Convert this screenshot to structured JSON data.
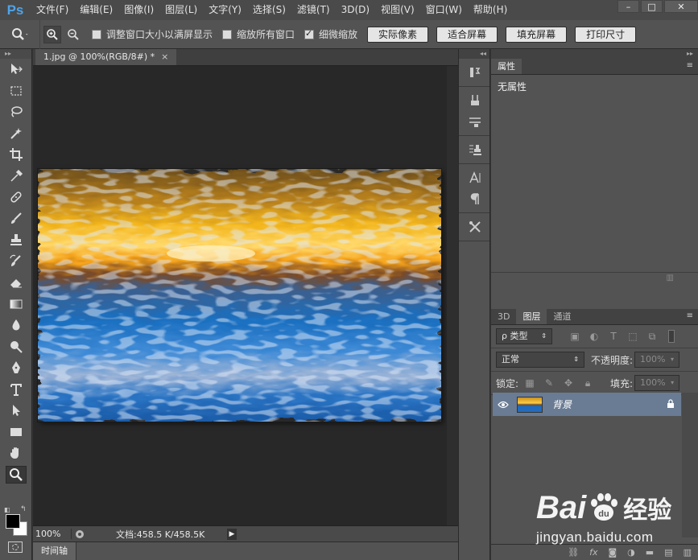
{
  "app": {
    "logo": "Ps"
  },
  "menu": [
    "文件(F)",
    "编辑(E)",
    "图像(I)",
    "图层(L)",
    "文字(Y)",
    "选择(S)",
    "滤镜(T)",
    "3D(D)",
    "视图(V)",
    "窗口(W)",
    "帮助(H)"
  ],
  "window_controls": {
    "minimize": "–",
    "maximize": "□",
    "close": "✕"
  },
  "options": {
    "resize_windows": {
      "label": "调整窗口大小以满屏显示",
      "checked": false
    },
    "zoom_all_windows": {
      "label": "缩放所有窗口",
      "checked": false
    },
    "scrubby_zoom": {
      "label": "细微缩放",
      "checked": true
    },
    "actual_pixels": "实际像素",
    "fit_screen": "适合屏幕",
    "fill_screen": "填充屏幕",
    "print_size": "打印尺寸"
  },
  "document": {
    "tab_title": "1.jpg @ 100%(RGB/8#) *",
    "tab_close": "×"
  },
  "status": {
    "zoom": "100%",
    "doc_info": "文档:458.5 K/458.5K",
    "arrow": "▶"
  },
  "timeline": {
    "label": "时间轴"
  },
  "properties": {
    "tab": "属性",
    "title": "无属性"
  },
  "layers_panel": {
    "tabs": [
      "3D",
      "图层",
      "通道"
    ],
    "filter_kind": "ρ 类型",
    "blend_mode": "正常",
    "opacity_label": "不透明度:",
    "opacity_value": "100%",
    "lock_label": "锁定:",
    "fill_label": "填充:",
    "fill_value": "100%",
    "layer_name": "背景"
  },
  "watermark": {
    "brand": "Bai",
    "brand2": "du",
    "cn": "经验",
    "url": "jingyan.baidu.com"
  },
  "colors": {
    "foreground": "#000000",
    "background": "#ffffff",
    "ps_blue": "#4fa3e8"
  }
}
